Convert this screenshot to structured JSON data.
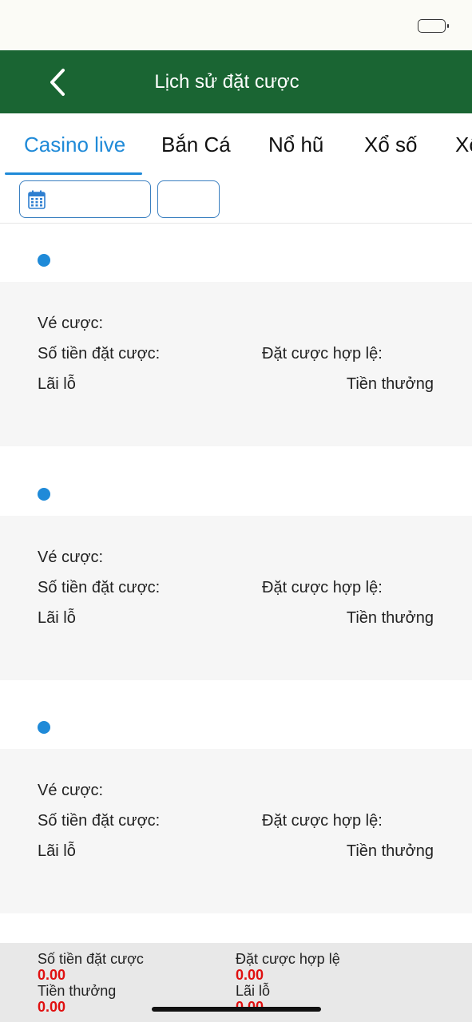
{
  "header": {
    "title": "Lịch sử đặt cược"
  },
  "tabs": [
    {
      "label": "Casino live",
      "active": true
    },
    {
      "label": "Bắn Cá",
      "active": false
    },
    {
      "label": "Nổ hũ",
      "active": false
    },
    {
      "label": "Xổ số",
      "active": false
    },
    {
      "label": "Xổ",
      "active": false
    }
  ],
  "records": [
    {
      "ticket_label": "Vé cược:",
      "bet_amount_label": "Số tiền đặt cược:",
      "valid_bet_label": "Đặt cược hợp lệ:",
      "profit_loss_label": "Lãi lỗ",
      "reward_label": "Tiền thưởng"
    },
    {
      "ticket_label": "Vé cược:",
      "bet_amount_label": "Số tiền đặt cược:",
      "valid_bet_label": "Đặt cược hợp lệ:",
      "profit_loss_label": "Lãi lỗ",
      "reward_label": "Tiền thưởng"
    },
    {
      "ticket_label": "Vé cược:",
      "bet_amount_label": "Số tiền đặt cược:",
      "valid_bet_label": "Đặt cược hợp lệ:",
      "profit_loss_label": "Lãi lỗ",
      "reward_label": "Tiền thưởng"
    }
  ],
  "summary": {
    "bet_amount": {
      "label": "Số tiền đặt cược",
      "value": "0.00"
    },
    "valid_bet": {
      "label": "Đặt cược hợp lệ",
      "value": "0.00"
    },
    "reward": {
      "label": "Tiền thưởng",
      "value": "0.00"
    },
    "profit_loss": {
      "label": "Lãi lỗ",
      "value": "0.00"
    }
  },
  "colors": {
    "header_bg": "#1a6533",
    "accent": "#1f8ad8",
    "value_red": "#e01010"
  }
}
